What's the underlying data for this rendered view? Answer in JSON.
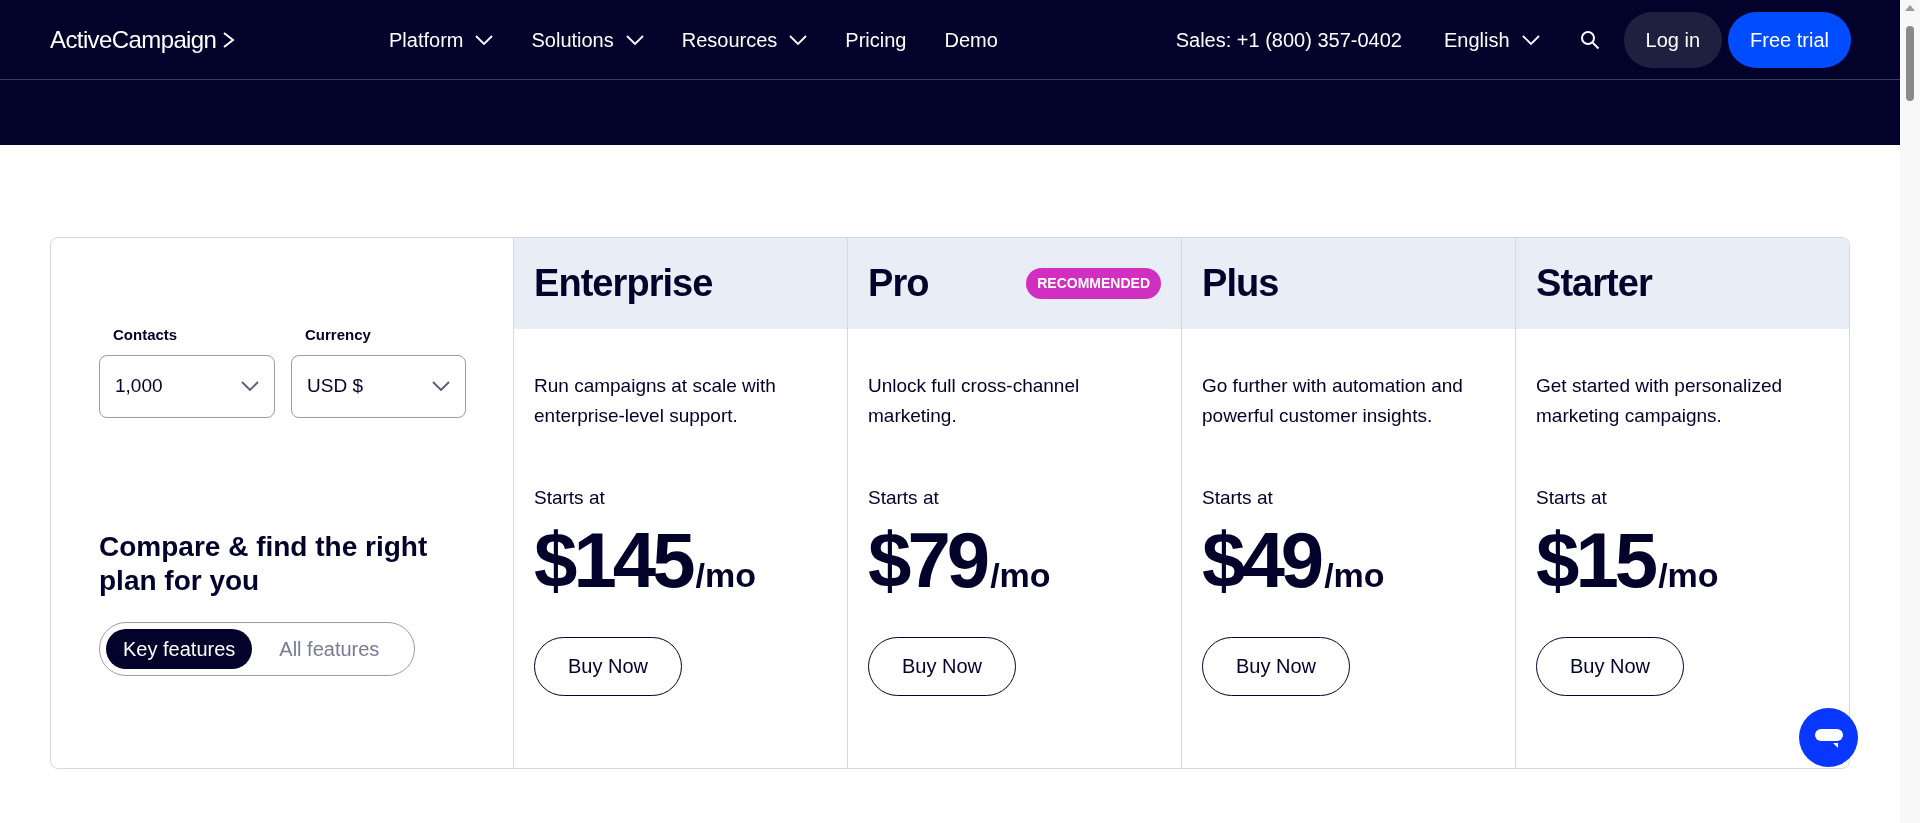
{
  "header": {
    "logo": "ActiveCampaign",
    "nav": [
      {
        "label": "Platform",
        "kind": "menu"
      },
      {
        "label": "Solutions",
        "kind": "menu"
      },
      {
        "label": "Resources",
        "kind": "menu"
      },
      {
        "label": "Pricing",
        "kind": "link"
      },
      {
        "label": "Demo",
        "kind": "link"
      }
    ],
    "sales": "Sales: +1 (800) 357-0402",
    "language": "English",
    "login": "Log in",
    "cta": "Free trial"
  },
  "filters": [
    {
      "label": "Contacts",
      "value": "1,000"
    },
    {
      "label": "Currency",
      "value": "USD $"
    }
  ],
  "heading": "Compare & find the right plan for you",
  "toggle": [
    {
      "label": "Key features",
      "selected": true
    },
    {
      "label": "All features",
      "selected": false
    }
  ],
  "plans": [
    {
      "name": "Enterprise",
      "description": "Run campaigns at scale with enterprise-level support.",
      "starts": "Starts at",
      "price": "$145",
      "period": "/mo",
      "button": "Buy Now"
    },
    {
      "name": "Pro",
      "badge": "RECOMMENDED",
      "description": "Unlock full cross-channel marketing.",
      "starts": "Starts at",
      "price": "$79",
      "period": "/mo",
      "button": "Buy Now"
    },
    {
      "name": "Plus",
      "description": "Go further with automation and powerful customer insights.",
      "starts": "Starts at",
      "price": "$49",
      "period": "/mo",
      "button": "Buy Now"
    },
    {
      "name": "Starter",
      "description": "Get started with personalized marketing campaigns.",
      "starts": "Starts at",
      "price": "$15",
      "period": "/mo",
      "button": "Buy Now"
    }
  ]
}
